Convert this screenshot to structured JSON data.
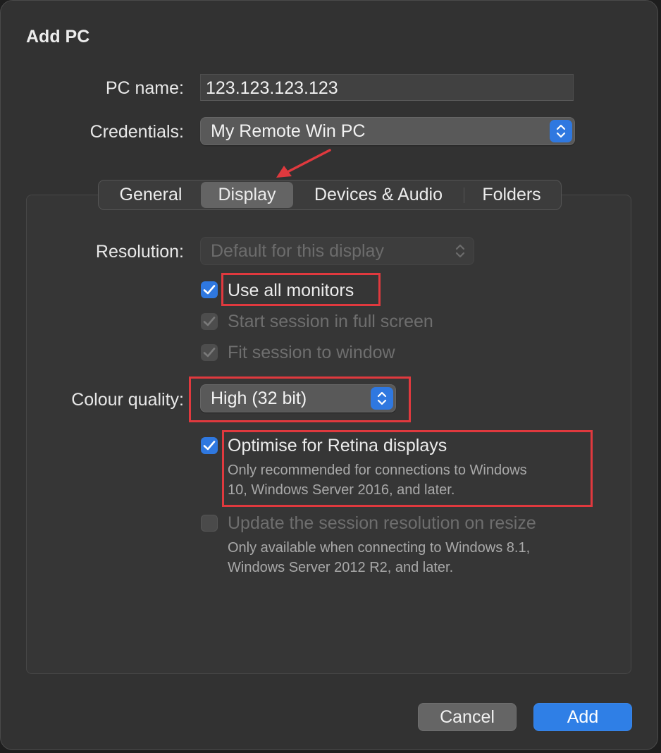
{
  "dialog": {
    "title": "Add PC"
  },
  "fields": {
    "pc_name_label": "PC name:",
    "pc_name_value": "123.123.123.123",
    "credentials_label": "Credentials:",
    "credentials_value": "My Remote Win PC"
  },
  "tabs": [
    {
      "label": "General",
      "active": false
    },
    {
      "label": "Display",
      "active": true
    },
    {
      "label": "Devices & Audio",
      "active": false
    },
    {
      "label": "Folders",
      "active": false
    }
  ],
  "display": {
    "resolution_label": "Resolution:",
    "resolution_value": "Default for this display",
    "use_all_monitors": {
      "label": "Use all monitors",
      "checked": true,
      "enabled": true
    },
    "start_full_screen": {
      "label": "Start session in full screen",
      "checked": true,
      "enabled": false
    },
    "fit_to_window": {
      "label": "Fit session to window",
      "checked": true,
      "enabled": false
    },
    "colour_quality_label": "Colour quality:",
    "colour_quality_value": "High (32 bit)",
    "optimise_retina": {
      "label": "Optimise for Retina displays",
      "checked": true,
      "enabled": true,
      "hint_line1": "Only recommended for connections to Windows",
      "hint_line2": "10, Windows Server 2016, and later."
    },
    "update_resolution": {
      "label": "Update the session resolution on resize",
      "checked": false,
      "enabled": false,
      "hint_line1": "Only available when connecting to Windows 8.1,",
      "hint_line2": "Windows Server 2012 R2, and later."
    }
  },
  "buttons": {
    "cancel": "Cancel",
    "add": "Add"
  },
  "colors": {
    "accent": "#2f78e0",
    "annotation": "#e0393e",
    "background": "#323232"
  }
}
